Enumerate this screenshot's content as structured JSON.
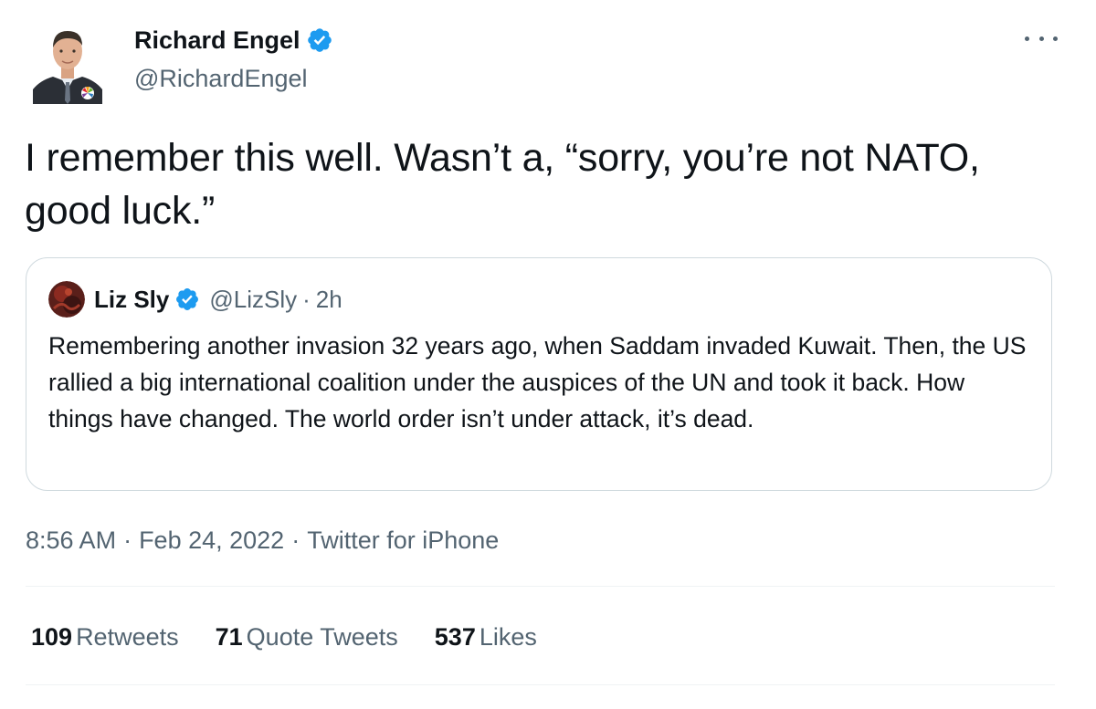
{
  "tweet": {
    "author": {
      "name": "Richard Engel",
      "handle": "@RichardEngel",
      "verified_icon": "verified-badge-icon"
    },
    "text": "I remember this well. Wasn’t a, “sorry, you’re not NATO, good luck.”",
    "more_icon": "more-options-icon"
  },
  "quote": {
    "author": {
      "name": "Liz Sly",
      "handle": "@LizSly",
      "separator": "·",
      "time": "2h"
    },
    "text": "Remembering another invasion 32 years ago, when Saddam invaded Kuwait. Then, the US rallied a big international coalition under the auspices of the UN and took it back. How things have changed. The world order isn’t under attack, it’s dead."
  },
  "meta": {
    "time": "8:56 AM",
    "separator": "·",
    "date": "Feb 24, 2022",
    "source": "Twitter for iPhone"
  },
  "stats": {
    "retweets": {
      "count": "109",
      "label": "Retweets"
    },
    "quotes": {
      "count": "71",
      "label": "Quote Tweets"
    },
    "likes": {
      "count": "537",
      "label": "Likes"
    }
  },
  "colors": {
    "text": "#0f1419",
    "secondary": "#536471",
    "verified": "#1d9bf0",
    "border": "#cfd9de",
    "divider": "#eff3f4"
  }
}
